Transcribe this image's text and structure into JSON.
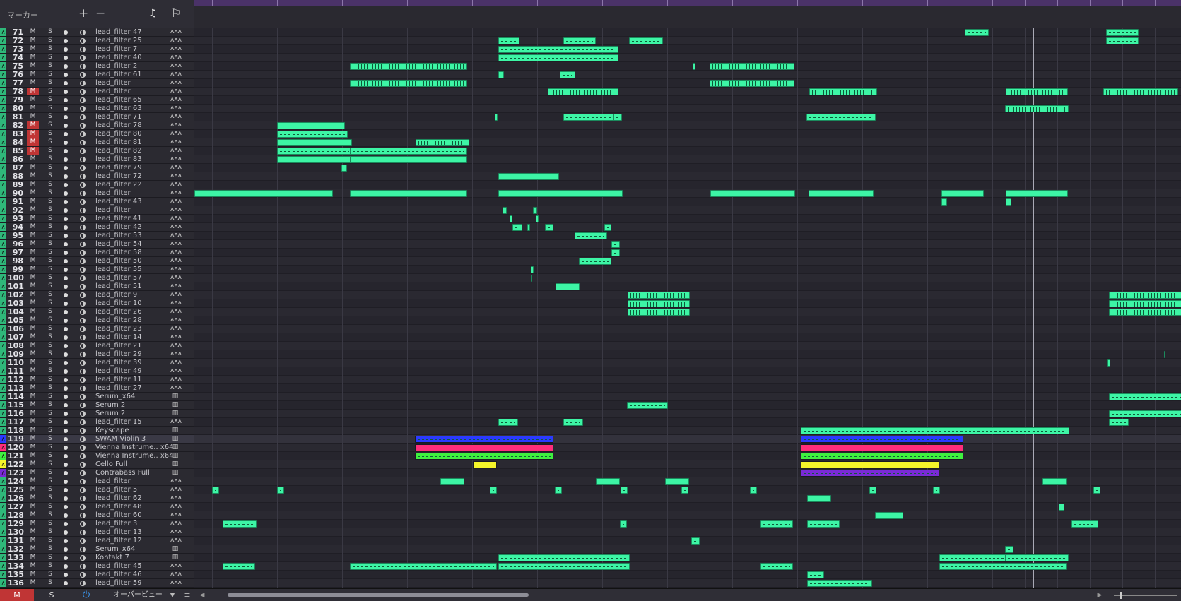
{
  "header": {
    "title": "マーカー",
    "add_icon": "+",
    "remove_icon": "−",
    "note_icon": "♫",
    "flag_icon": "⚐"
  },
  "colors": {
    "clip": "#3df5a5",
    "blue": "#2a3aff",
    "pink": "#ff2d7a",
    "green": "#3ff03f",
    "yellow": "#f5f52a",
    "purple": "#7a2ad6",
    "mute_on": "#c03535"
  },
  "tracks": [
    {
      "n": "71",
      "name": "lead_filter 47",
      "m": false,
      "icon": "wave"
    },
    {
      "n": "72",
      "name": "lead_filter 25",
      "m": false,
      "icon": "wave"
    },
    {
      "n": "73",
      "name": "lead_filter 7",
      "m": false,
      "icon": "wave"
    },
    {
      "n": "74",
      "name": "lead_filter 40",
      "m": false,
      "icon": "wave"
    },
    {
      "n": "75",
      "name": "lead_filter 2",
      "m": false,
      "icon": "wave"
    },
    {
      "n": "76",
      "name": "lead_filter 61",
      "m": false,
      "icon": "wave"
    },
    {
      "n": "77",
      "name": "lead_filter",
      "m": false,
      "icon": "wave"
    },
    {
      "n": "78",
      "name": "lead_filter",
      "m": true,
      "icon": "wave"
    },
    {
      "n": "79",
      "name": "lead_filter 65",
      "m": false,
      "icon": "wave"
    },
    {
      "n": "80",
      "name": "lead_filter 63",
      "m": false,
      "icon": "wave"
    },
    {
      "n": "81",
      "name": "lead_filter 71",
      "m": false,
      "icon": "wave"
    },
    {
      "n": "82",
      "name": "lead_filter 78",
      "m": true,
      "icon": "wave"
    },
    {
      "n": "83",
      "name": "lead_filter 80",
      "m": true,
      "icon": "wave"
    },
    {
      "n": "84",
      "name": "lead_filter 81",
      "m": true,
      "icon": "wave"
    },
    {
      "n": "85",
      "name": "lead_filter 82",
      "m": true,
      "icon": "wave"
    },
    {
      "n": "86",
      "name": "lead_filter 83",
      "m": false,
      "icon": "wave"
    },
    {
      "n": "87",
      "name": "lead_filter 79",
      "m": false,
      "icon": "wave"
    },
    {
      "n": "88",
      "name": "lead_filter 72",
      "m": false,
      "icon": "wave"
    },
    {
      "n": "89",
      "name": "lead_filter 22",
      "m": false,
      "icon": "wave"
    },
    {
      "n": "90",
      "name": "lead_filter",
      "m": false,
      "icon": "wave"
    },
    {
      "n": "91",
      "name": "lead_filter 43",
      "m": false,
      "icon": "wave"
    },
    {
      "n": "92",
      "name": "lead_filter",
      "m": false,
      "icon": "wave"
    },
    {
      "n": "93",
      "name": "lead_filter 41",
      "m": false,
      "icon": "wave"
    },
    {
      "n": "94",
      "name": "lead_filter 42",
      "m": false,
      "icon": "wave"
    },
    {
      "n": "95",
      "name": "lead_filter 53",
      "m": false,
      "icon": "wave"
    },
    {
      "n": "96",
      "name": "lead_filter 54",
      "m": false,
      "icon": "wave"
    },
    {
      "n": "97",
      "name": "lead_filter 58",
      "m": false,
      "icon": "wave"
    },
    {
      "n": "98",
      "name": "lead_filter 50",
      "m": false,
      "icon": "wave"
    },
    {
      "n": "99",
      "name": "lead_filter 55",
      "m": false,
      "icon": "wave"
    },
    {
      "n": "100",
      "name": "lead_filter 57",
      "m": false,
      "icon": "wave"
    },
    {
      "n": "101",
      "name": "lead_filter 51",
      "m": false,
      "icon": "wave"
    },
    {
      "n": "102",
      "name": "lead_filter 9",
      "m": false,
      "icon": "wave"
    },
    {
      "n": "103",
      "name": "lead_filter 10",
      "m": false,
      "icon": "wave"
    },
    {
      "n": "104",
      "name": "lead_filter 26",
      "m": false,
      "icon": "wave"
    },
    {
      "n": "105",
      "name": "lead_filter 28",
      "m": false,
      "icon": "wave"
    },
    {
      "n": "106",
      "name": "lead_filter 23",
      "m": false,
      "icon": "wave"
    },
    {
      "n": "107",
      "name": "lead_filter 14",
      "m": false,
      "icon": "wave"
    },
    {
      "n": "108",
      "name": "lead_filter 21",
      "m": false,
      "icon": "wave"
    },
    {
      "n": "109",
      "name": "lead_filter 29",
      "m": false,
      "icon": "wave"
    },
    {
      "n": "110",
      "name": "lead_filter 39",
      "m": false,
      "icon": "wave"
    },
    {
      "n": "111",
      "name": "lead_filter 49",
      "m": false,
      "icon": "wave"
    },
    {
      "n": "112",
      "name": "lead_filter 11",
      "m": false,
      "icon": "wave"
    },
    {
      "n": "113",
      "name": "lead_filter 27",
      "m": false,
      "icon": "wave"
    },
    {
      "n": "114",
      "name": "Serum_x64",
      "m": false,
      "icon": "keys"
    },
    {
      "n": "115",
      "name": "Serum 2",
      "m": false,
      "icon": "keys"
    },
    {
      "n": "116",
      "name": "Serum 2",
      "m": false,
      "icon": "keys"
    },
    {
      "n": "117",
      "name": "lead_filter 15",
      "m": false,
      "icon": "wave"
    },
    {
      "n": "118",
      "name": "Keyscape",
      "m": false,
      "icon": "keys"
    },
    {
      "n": "119",
      "name": "SWAM Violin 3",
      "m": false,
      "icon": "keys",
      "sel": true,
      "color": "#2a3aff"
    },
    {
      "n": "120",
      "name": "Vienna Instrume.. x64",
      "m": false,
      "icon": "keys",
      "color": "#ff2d7a"
    },
    {
      "n": "121",
      "name": "Vienna Instrume.. x64",
      "m": false,
      "icon": "keys",
      "color": "#3ff03f"
    },
    {
      "n": "122",
      "name": "Cello Full",
      "m": false,
      "icon": "keys",
      "color": "#f5f52a"
    },
    {
      "n": "123",
      "name": "Contrabass Full",
      "m": false,
      "icon": "keys",
      "color": "#7a2ad6"
    },
    {
      "n": "124",
      "name": "lead_filter",
      "m": false,
      "icon": "wave"
    },
    {
      "n": "125",
      "name": "lead_filter 5",
      "m": false,
      "icon": "wave"
    },
    {
      "n": "126",
      "name": "lead_filter 62",
      "m": false,
      "icon": "wave"
    },
    {
      "n": "127",
      "name": "lead_filter 48",
      "m": false,
      "icon": "wave"
    },
    {
      "n": "128",
      "name": "lead_filter 60",
      "m": false,
      "icon": "wave"
    },
    {
      "n": "129",
      "name": "lead_filter 3",
      "m": false,
      "icon": "wave"
    },
    {
      "n": "130",
      "name": "lead_filter 13",
      "m": false,
      "icon": "wave"
    },
    {
      "n": "131",
      "name": "lead_filter 12",
      "m": false,
      "icon": "wave"
    },
    {
      "n": "132",
      "name": "Serum_x64",
      "m": false,
      "icon": "keys"
    },
    {
      "n": "133",
      "name": "Kontakt 7",
      "m": false,
      "icon": "keys"
    },
    {
      "n": "134",
      "name": "lead_filter 45",
      "m": false,
      "icon": "wave"
    },
    {
      "n": "135",
      "name": "lead_filter 46",
      "m": false,
      "icon": "wave"
    },
    {
      "n": "136",
      "name": "lead_filter 59",
      "m": false,
      "icon": "wave"
    }
  ],
  "track_labels": {
    "m": "M",
    "s": "S",
    "wave_icon": "ʌʌʌ",
    "keys_icon": "▥"
  },
  "footer": {
    "m_label": "M",
    "s_label": "S",
    "power_icon": "⏻",
    "overview_label": "オーバービュー",
    "dropdown_icon": "▼",
    "menu_icon": "≡",
    "left_arrow": "◀",
    "right_arrow": "▶"
  }
}
